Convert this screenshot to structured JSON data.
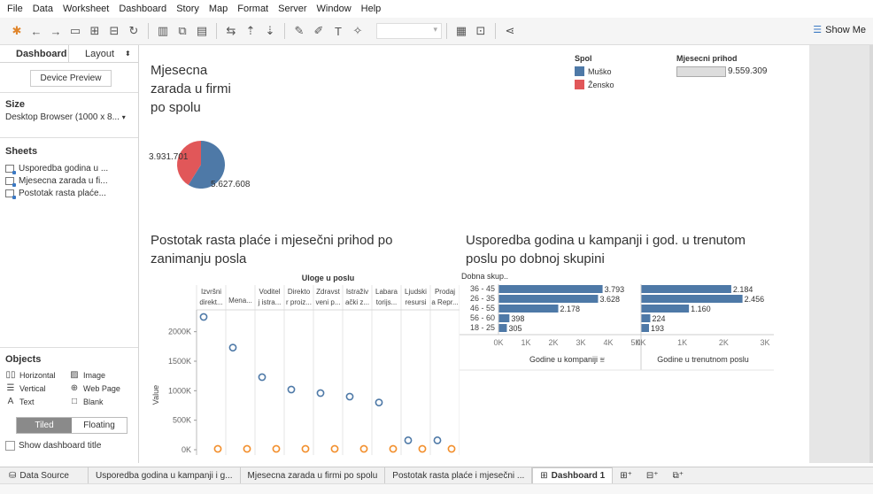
{
  "menu": [
    "File",
    "Data",
    "Worksheet",
    "Dashboard",
    "Story",
    "Map",
    "Format",
    "Server",
    "Window",
    "Help"
  ],
  "toolbar": {
    "show_me": "Show Me"
  },
  "left_panel": {
    "tab_dashboard": "Dashboard",
    "tab_layout": "Layout",
    "device_preview": "Device Preview",
    "size_title": "Size",
    "size_value": "Desktop Browser (1000 x 8...",
    "sheets_title": "Sheets",
    "sheets": [
      "Usporedba godina u ...",
      "Mjesecna zarada u fi...",
      "Postotak rasta plaće..."
    ],
    "objects_title": "Objects",
    "objects": [
      "Horizontal",
      "Image",
      "Vertical",
      "Web Page",
      "Text",
      "Blank"
    ],
    "tiled": "Tiled",
    "floating": "Floating",
    "show_title": "Show dashboard title"
  },
  "pie": {
    "title_lines": [
      "Mjesecna",
      "zarada u firmi",
      "po spolu"
    ],
    "legend_title": "Spol",
    "legend": [
      {
        "label": "Muško",
        "color": "#4e79a7"
      },
      {
        "label": "Žensko",
        "color": "#e15759"
      }
    ],
    "income_title": "Mjesecni prihod",
    "income_value": "9.559.309"
  },
  "scatter": {
    "title_lines": [
      "Postotak rasta plaće i mjesečni prihod po",
      "zanimanju posla"
    ],
    "column_header": "Uloge u poslu",
    "y_axis_label": "Value",
    "y_ticks": [
      "2000K",
      "1500K",
      "1000K",
      "500K",
      "0K"
    ],
    "categories": [
      [
        "Izvršni",
        "direkt..."
      ],
      [
        "Mena..."
      ],
      [
        "Voditel",
        "j istra..."
      ],
      [
        "Direkto",
        "r proiz..."
      ],
      [
        "Zdravst",
        "veni p..."
      ],
      [
        "Istraživ",
        "ački z..."
      ],
      [
        "Labara",
        "torijs..."
      ],
      [
        "Ljudski",
        "resursi"
      ],
      [
        "Prodaj",
        "a Repr..."
      ]
    ]
  },
  "bars": {
    "title_lines": [
      "Usporedba godina u kampanji i god. u trenutom",
      "poslu po dobnoj skupini"
    ],
    "row_header": "Dobna skup..",
    "left_axis_title": "Godine u kompaniji",
    "left_ticks": [
      "0K",
      "1K",
      "2K",
      "3K",
      "4K",
      "5K"
    ],
    "right_axis_title": "Godine u trenutnom poslu",
    "right_ticks": [
      "0K",
      "1K",
      "2K",
      "3K"
    ]
  },
  "chart_data": [
    {
      "type": "pie",
      "title": "Mjesecna zarada u firmi po spolu",
      "categories": [
        "Muško",
        "Žensko"
      ],
      "values": [
        5627608,
        3931701
      ],
      "labels": [
        "5.627.608",
        "3.931.701"
      ]
    },
    {
      "type": "scatter",
      "title": "Postotak rasta plaće i mjesečni prihod po zanimanju posla",
      "xlabel": "Uloge u poslu",
      "ylabel": "Value",
      "ylim": [
        0,
        2250000
      ],
      "categories": [
        "Izvršni direkt...",
        "Mena...",
        "Voditelj istra...",
        "Direktor proiz...",
        "Zdravsteni p...",
        "Istraživački z...",
        "Labaratorijs...",
        "Ljudski resursi",
        "Prodaja Repr..."
      ],
      "series": [
        {
          "color": "#4e79a7",
          "values": [
            2250000,
            1730000,
            1230000,
            1020000,
            960000,
            900000,
            800000,
            160000,
            160000
          ]
        },
        {
          "color": "#f28e2b",
          "values": [
            15000,
            15000,
            15000,
            15000,
            15000,
            15000,
            15000,
            15000,
            15000
          ]
        }
      ]
    },
    {
      "type": "bar",
      "title": "Usporedba godina u kampanji i god. u trenutom poslu po dobnoj skupini",
      "ylabel": "Dobna skup..",
      "categories": [
        "36 - 45",
        "26 - 35",
        "46 - 55",
        "56 - 60",
        "18 - 25"
      ],
      "series": [
        {
          "name": "Godine u kompaniji",
          "values": [
            3793,
            3628,
            2178,
            398,
            305
          ],
          "labels": [
            "3.793",
            "3.628",
            "2.178",
            "398",
            "305"
          ],
          "xlim": [
            0,
            5000
          ]
        },
        {
          "name": "Godine u trenutnom poslu",
          "values": [
            2184,
            2456,
            1160,
            224,
            193
          ],
          "labels": [
            "2.184",
            "2.456",
            "1.160",
            "224",
            "193"
          ],
          "xlim": [
            0,
            3000
          ]
        }
      ]
    }
  ],
  "tabs": {
    "data_source": "Data Source",
    "sheets": [
      "Usporedba godina u kampanji i g...",
      "Mjesecna zarada u firmi po spolu",
      "Postotak rasta plaće i mjesečni ..."
    ],
    "active": "Dashboard 1"
  }
}
